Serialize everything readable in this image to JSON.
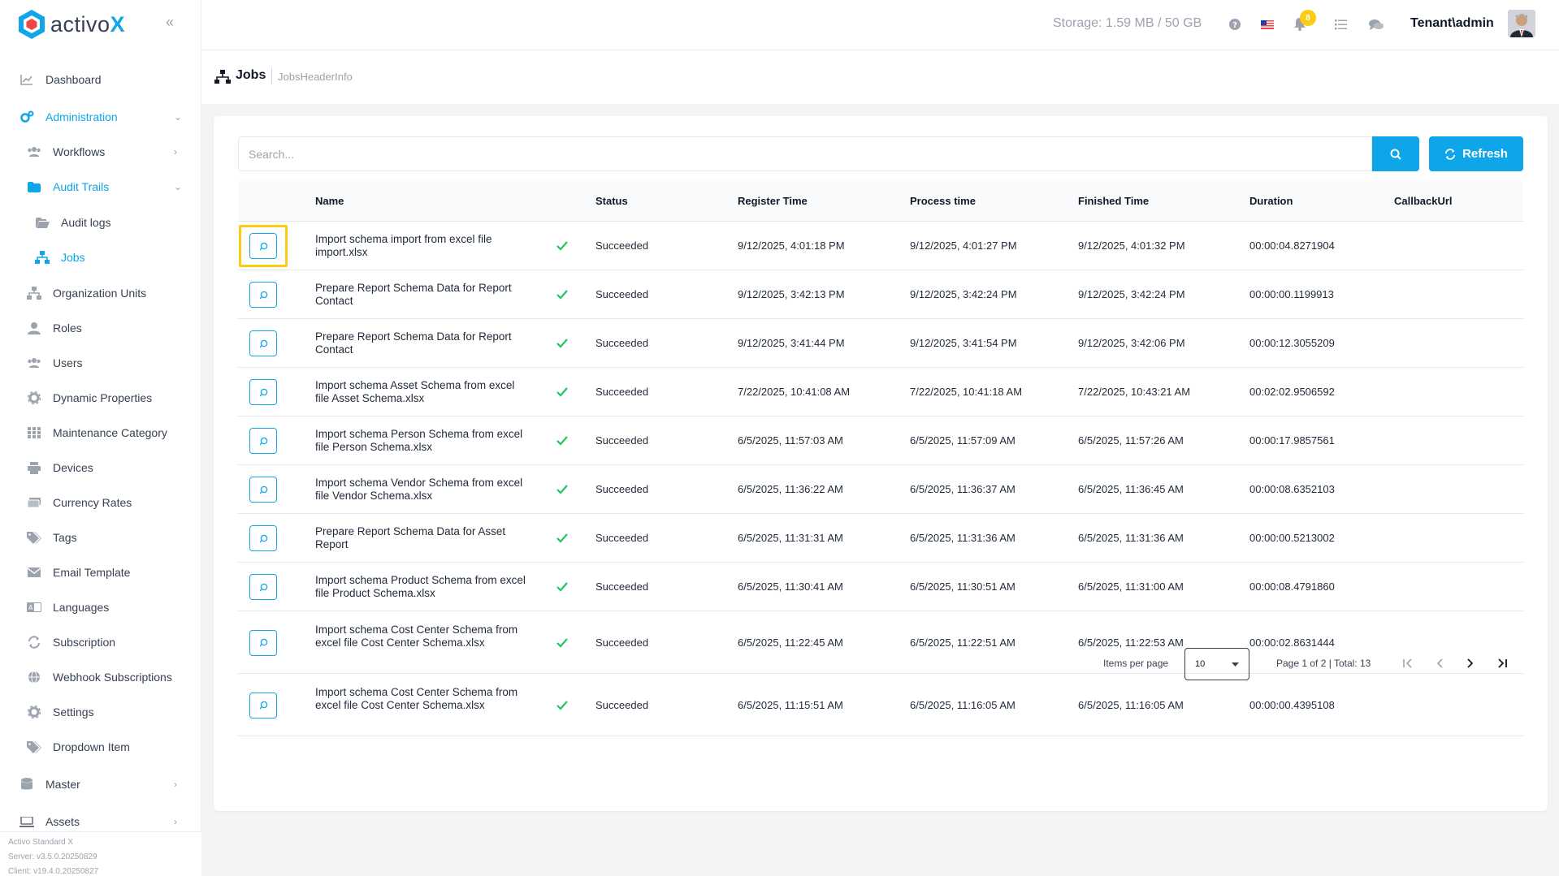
{
  "app": {
    "logo_text_left": "activo",
    "logo_text_right": "X"
  },
  "sidebar": {
    "items": [
      {
        "label": "Dashboard",
        "icon": "chart-line-icon"
      },
      {
        "label": "Administration",
        "icon": "cogs-icon"
      },
      {
        "label": "Workflows",
        "icon": "users-group-icon"
      },
      {
        "label": "Audit Trails",
        "icon": "folder-icon"
      },
      {
        "label": "Audit logs",
        "icon": "folder-open-icon"
      },
      {
        "label": "Jobs",
        "icon": "sitemap-icon"
      },
      {
        "label": "Organization Units",
        "icon": "sitemap-icon"
      },
      {
        "label": "Roles",
        "icon": "user-tie-icon"
      },
      {
        "label": "Users",
        "icon": "users-icon"
      },
      {
        "label": "Dynamic Properties",
        "icon": "gear-icon"
      },
      {
        "label": "Maintenance Category",
        "icon": "grid-icon"
      },
      {
        "label": "Devices",
        "icon": "printer-icon"
      },
      {
        "label": "Currency Rates",
        "icon": "money-icon"
      },
      {
        "label": "Tags",
        "icon": "tags-icon"
      },
      {
        "label": "Email Template",
        "icon": "envelope-icon"
      },
      {
        "label": "Languages",
        "icon": "language-icon"
      },
      {
        "label": "Subscription",
        "icon": "sync-icon"
      },
      {
        "label": "Webhook Subscriptions",
        "icon": "globe-icon"
      },
      {
        "label": "Settings",
        "icon": "gear-icon"
      },
      {
        "label": "Dropdown Item",
        "icon": "tags-icon"
      },
      {
        "label": "Master",
        "icon": "database-icon"
      },
      {
        "label": "Assets",
        "icon": "laptop-icon"
      }
    ],
    "footer": {
      "product": "Activo Standard X",
      "server": "Server: v3.5.0.20250829",
      "client": "Client: v19.4.0.20250827"
    }
  },
  "header": {
    "storage": "Storage: 1.59 MB / 50 GB",
    "notifications_count": "8",
    "user": "Tenant\\admin"
  },
  "page": {
    "title": "Jobs",
    "subtitle": "JobsHeaderInfo"
  },
  "toolbar": {
    "search_placeholder": "Search...",
    "refresh_label": "Refresh"
  },
  "table": {
    "columns": [
      "Name",
      "Status",
      "Register Time",
      "Process time",
      "Finished Time",
      "Duration",
      "CallbackUrl"
    ],
    "rows": [
      {
        "name": "Import schema import from excel file import.xlsx",
        "status": "Succeeded",
        "register": "9/12/2025, 4:01:18 PM",
        "process": "9/12/2025, 4:01:27 PM",
        "finished": "9/12/2025, 4:01:32 PM",
        "duration": "00:00:04.8271904",
        "callback": ""
      },
      {
        "name": "Prepare Report Schema Data for Report Contact",
        "status": "Succeeded",
        "register": "9/12/2025, 3:42:13 PM",
        "process": "9/12/2025, 3:42:24 PM",
        "finished": "9/12/2025, 3:42:24 PM",
        "duration": "00:00:00.1199913",
        "callback": ""
      },
      {
        "name": "Prepare Report Schema Data for Report Contact",
        "status": "Succeeded",
        "register": "9/12/2025, 3:41:44 PM",
        "process": "9/12/2025, 3:41:54 PM",
        "finished": "9/12/2025, 3:42:06 PM",
        "duration": "00:00:12.3055209",
        "callback": ""
      },
      {
        "name": "Import schema Asset Schema from excel file Asset Schema.xlsx",
        "status": "Succeeded",
        "register": "7/22/2025, 10:41:08 AM",
        "process": "7/22/2025, 10:41:18 AM",
        "finished": "7/22/2025, 10:43:21 AM",
        "duration": "00:02:02.9506592",
        "callback": ""
      },
      {
        "name": "Import schema Person Schema from excel file Person Schema.xlsx",
        "status": "Succeeded",
        "register": "6/5/2025, 11:57:03 AM",
        "process": "6/5/2025, 11:57:09 AM",
        "finished": "6/5/2025, 11:57:26 AM",
        "duration": "00:00:17.9857561",
        "callback": ""
      },
      {
        "name": "Import schema Vendor Schema from excel file Vendor Schema.xlsx",
        "status": "Succeeded",
        "register": "6/5/2025, 11:36:22 AM",
        "process": "6/5/2025, 11:36:37 AM",
        "finished": "6/5/2025, 11:36:45 AM",
        "duration": "00:00:08.6352103",
        "callback": ""
      },
      {
        "name": "Prepare Report Schema Data for Asset Report",
        "status": "Succeeded",
        "register": "6/5/2025, 11:31:31 AM",
        "process": "6/5/2025, 11:31:36 AM",
        "finished": "6/5/2025, 11:31:36 AM",
        "duration": "00:00:00.5213002",
        "callback": ""
      },
      {
        "name": "Import schema Product Schema from excel file Product Schema.xlsx",
        "status": "Succeeded",
        "register": "6/5/2025, 11:30:41 AM",
        "process": "6/5/2025, 11:30:51 AM",
        "finished": "6/5/2025, 11:31:00 AM",
        "duration": "00:00:08.4791860",
        "callback": ""
      },
      {
        "name": "Import schema Cost Center Schema from excel file Cost Center Schema.xlsx",
        "status": "Succeeded",
        "register": "6/5/2025, 11:22:45 AM",
        "process": "6/5/2025, 11:22:51 AM",
        "finished": "6/5/2025, 11:22:53 AM",
        "duration": "00:00:02.8631444",
        "callback": ""
      },
      {
        "name": "Import schema Cost Center Schema from excel file Cost Center Schema.xlsx",
        "status": "Succeeded",
        "register": "6/5/2025, 11:15:51 AM",
        "process": "6/5/2025, 11:16:05 AM",
        "finished": "6/5/2025, 11:16:05 AM",
        "duration": "00:00:00.4395108",
        "callback": ""
      }
    ]
  },
  "pagination": {
    "items_per_page_label": "Items per page",
    "items_per_page_value": "10",
    "info": "Page 1 of 2 | Total: 13"
  },
  "colors": {
    "accent": "#0ea5e9",
    "success": "#22c55e",
    "highlight": "#facc15"
  }
}
